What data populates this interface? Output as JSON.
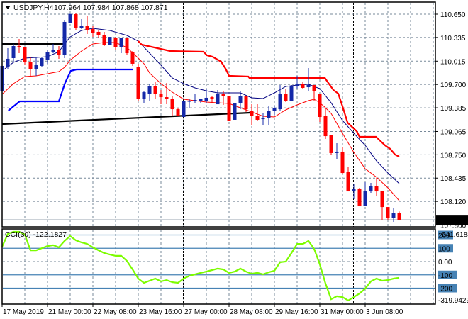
{
  "window": {
    "symbol_title": "USDJPY,H4",
    "ohlc_readout": "107.964 107.984 107.868 107.871",
    "menu_icon": "triangle-down-icon"
  },
  "colors": {
    "bull_candle": "#1428a8",
    "bear_candle": "#ff0000",
    "ma_navy": "#000080",
    "ma_red": "#ff0000",
    "stop_red": "#ff0000",
    "stop_blue": "#0000ff",
    "trendline": "#000000",
    "cci_line": "#7cfc00",
    "cci_levels": "#4682b4",
    "grid": "#778899",
    "current_price_bg": "#000000"
  },
  "chart_data": [
    {
      "type": "candlestick",
      "title": "USDJPY,H4",
      "grid": true,
      "x_tick_labels": [
        {
          "bar": 0,
          "label": "17 May 2019"
        },
        {
          "bar": 8,
          "label": "21 May 00:00"
        },
        {
          "bar": 16,
          "label": "22 May 08:00"
        },
        {
          "bar": 24,
          "label": "23 May 16:00"
        },
        {
          "bar": 32,
          "label": "27 May 00:00"
        },
        {
          "bar": 40,
          "label": "28 May 08:00"
        },
        {
          "bar": 48,
          "label": "29 May 16:00"
        },
        {
          "bar": 56,
          "label": "31 May 00:00"
        },
        {
          "bar": 64,
          "label": "3 Jun 08:00"
        }
      ],
      "period_separators_bars": [
        2,
        32,
        62
      ],
      "y_ticks": [
        "110.650",
        "110.335",
        "110.015",
        "109.700",
        "109.385",
        "109.065",
        "108.750",
        "108.435",
        "108.120",
        "107.800"
      ],
      "current_price": "107.871",
      "ohlc": [
        [
          109.615,
          109.98,
          109.596,
          109.951
        ],
        [
          109.932,
          110.19,
          109.903,
          110.047
        ],
        [
          110.056,
          110.248,
          110.008,
          110.219
        ],
        [
          110.219,
          110.315,
          110.123,
          110.2
        ],
        [
          110.209,
          110.209,
          109.96,
          109.999
        ],
        [
          110.008,
          110.066,
          109.817,
          109.912
        ],
        [
          109.912,
          110.066,
          109.817,
          109.96
        ],
        [
          109.951,
          110.066,
          109.941,
          110.056
        ],
        [
          110.037,
          110.171,
          109.98,
          110.142
        ],
        [
          110.142,
          110.248,
          110.123,
          110.171
        ],
        [
          110.171,
          110.219,
          110.047,
          110.104
        ],
        [
          110.104,
          110.573,
          110.056,
          110.545
        ],
        [
          110.535,
          110.66,
          110.525,
          110.65
        ],
        [
          110.65,
          110.66,
          110.439,
          110.468
        ],
        [
          110.468,
          110.583,
          110.449,
          110.487
        ],
        [
          110.487,
          110.621,
          110.382,
          110.439
        ],
        [
          110.449,
          110.487,
          110.343,
          110.401
        ],
        [
          110.411,
          110.439,
          110.334,
          110.363
        ],
        [
          110.372,
          110.411,
          110.219,
          110.238
        ],
        [
          110.238,
          110.343,
          110.238,
          110.343
        ],
        [
          110.334,
          110.343,
          110.171,
          110.2
        ],
        [
          110.2,
          110.334,
          110.123,
          110.334
        ],
        [
          110.334,
          110.334,
          110.094,
          110.123
        ],
        [
          110.142,
          110.152,
          109.951,
          109.98
        ],
        [
          109.932,
          109.98,
          109.472,
          109.501
        ],
        [
          109.501,
          109.615,
          109.453,
          109.596
        ],
        [
          109.568,
          109.711,
          109.472,
          109.673
        ],
        [
          109.673,
          109.74,
          109.501,
          109.568
        ],
        [
          109.577,
          109.625,
          109.433,
          109.529
        ],
        [
          109.529,
          109.721,
          109.433,
          109.501
        ],
        [
          109.51,
          109.548,
          109.271,
          109.366
        ],
        [
          109.366,
          109.386,
          109.271,
          109.271
        ],
        [
          109.261,
          109.472,
          109.261,
          109.472
        ],
        [
          109.472,
          109.501,
          109.386,
          109.481
        ],
        [
          109.472,
          109.577,
          109.443,
          109.491
        ],
        [
          109.472,
          109.501,
          109.443,
          109.501
        ],
        [
          109.481,
          109.644,
          109.443,
          109.52
        ],
        [
          109.529,
          109.539,
          109.453,
          109.501
        ],
        [
          109.433,
          109.625,
          109.433,
          109.577
        ],
        [
          109.577,
          109.606,
          109.424,
          109.548
        ],
        [
          109.539,
          109.539,
          109.213,
          109.213
        ],
        [
          109.223,
          109.443,
          109.223,
          109.443
        ],
        [
          109.443,
          109.606,
          109.366,
          109.539
        ],
        [
          109.539,
          109.548,
          109.328,
          109.366
        ],
        [
          109.338,
          109.433,
          109.146,
          109.271
        ],
        [
          109.271,
          109.433,
          109.213,
          109.223
        ],
        [
          109.232,
          109.309,
          109.146,
          109.251
        ],
        [
          109.242,
          109.414,
          109.156,
          109.347
        ],
        [
          109.338,
          109.414,
          109.29,
          109.376
        ],
        [
          109.366,
          109.692,
          109.338,
          109.568
        ],
        [
          109.568,
          109.635,
          109.462,
          109.481
        ],
        [
          109.481,
          109.692,
          109.472,
          109.673
        ],
        [
          109.673,
          109.817,
          109.635,
          109.702
        ],
        [
          109.702,
          109.74,
          109.635,
          109.654
        ],
        [
          109.663,
          109.922,
          109.615,
          109.692
        ],
        [
          109.692,
          109.692,
          109.472,
          109.606
        ],
        [
          109.568,
          109.568,
          109.194,
          109.261
        ],
        [
          109.271,
          109.386,
          108.964,
          109.002
        ],
        [
          109.012,
          109.022,
          108.744,
          108.773
        ],
        [
          108.773,
          108.907,
          108.696,
          108.792
        ],
        [
          108.792,
          108.859,
          108.495,
          108.504
        ],
        [
          108.514,
          108.581,
          108.255,
          108.255
        ],
        [
          108.255,
          108.351,
          108.15,
          108.284
        ],
        [
          108.294,
          108.303,
          108.054,
          108.054
        ],
        [
          108.063,
          108.38,
          108.063,
          108.265
        ],
        [
          108.255,
          108.37,
          108.236,
          108.332
        ],
        [
          108.332,
          108.437,
          108.188,
          108.255
        ],
        [
          108.265,
          108.265,
          107.872,
          108.044
        ],
        [
          108.044,
          108.044,
          107.872,
          107.901
        ],
        [
          107.901,
          108.035,
          107.843,
          107.968
        ],
        [
          107.964,
          107.984,
          107.868,
          107.871
        ]
      ],
      "overlays": [
        {
          "style": "ma_navy",
          "points": [
            [
              0,
              109.884
            ],
            [
              2,
              109.999
            ],
            [
              4,
              110.056
            ],
            [
              6,
              110.066
            ],
            [
              8,
              110.075
            ],
            [
              10,
              110.142
            ],
            [
              11,
              110.248
            ],
            [
              12,
              110.343
            ],
            [
              14,
              110.43
            ],
            [
              16,
              110.458
            ],
            [
              19,
              110.43
            ],
            [
              22,
              110.363
            ],
            [
              24,
              110.286
            ],
            [
              26,
              110.123
            ],
            [
              28,
              109.96
            ],
            [
              30,
              109.788
            ],
            [
              32,
              109.711
            ],
            [
              34,
              109.654
            ],
            [
              36,
              109.615
            ],
            [
              38,
              109.587
            ],
            [
              42,
              109.587
            ],
            [
              44,
              109.52
            ],
            [
              46,
              109.51
            ],
            [
              48,
              109.587
            ],
            [
              50,
              109.673
            ],
            [
              52,
              109.692
            ],
            [
              54,
              109.702
            ],
            [
              56,
              109.644
            ],
            [
              58,
              109.453
            ],
            [
              60,
              109.213
            ],
            [
              62,
              109.041
            ],
            [
              64,
              108.878
            ],
            [
              66,
              108.667
            ],
            [
              68,
              108.504
            ],
            [
              70,
              108.361
            ]
          ]
        },
        {
          "style": "ma_red",
          "points": [
            [
              0,
              109.568
            ],
            [
              2,
              109.711
            ],
            [
              4,
              109.807
            ],
            [
              6,
              109.817
            ],
            [
              8,
              109.845
            ],
            [
              10,
              109.874
            ],
            [
              11,
              109.932
            ],
            [
              12,
              110.027
            ],
            [
              14,
              110.152
            ],
            [
              16,
              110.248
            ],
            [
              18,
              110.267
            ],
            [
              20,
              110.267
            ],
            [
              22,
              110.2
            ],
            [
              24,
              110.056
            ],
            [
              25,
              109.98
            ],
            [
              26,
              109.855
            ],
            [
              28,
              109.711
            ],
            [
              30,
              109.596
            ],
            [
              32,
              109.501
            ],
            [
              36,
              109.462
            ],
            [
              40,
              109.443
            ],
            [
              44,
              109.328
            ],
            [
              46,
              109.271
            ],
            [
              48,
              109.261
            ],
            [
              50,
              109.357
            ],
            [
              52,
              109.424
            ],
            [
              54,
              109.481
            ],
            [
              55,
              109.501
            ],
            [
              56,
              109.453
            ],
            [
              57,
              109.386
            ],
            [
              58,
              109.309
            ],
            [
              60,
              109.041
            ],
            [
              62,
              108.782
            ],
            [
              64,
              108.562
            ],
            [
              66,
              108.447
            ],
            [
              68,
              108.303
            ],
            [
              70,
              108.131
            ]
          ]
        },
        {
          "style": "stop_red",
          "points": [
            [
              24,
              110.286
            ],
            [
              24.6,
              110.238
            ],
            [
              29.6,
              110.152
            ],
            [
              35.5,
              110.142
            ],
            [
              36.1,
              110.094
            ],
            [
              37.1,
              110.075
            ],
            [
              38.6,
              110.008
            ],
            [
              39.4,
              109.912
            ],
            [
              40,
              109.817
            ],
            [
              43.4,
              109.807
            ],
            [
              43.6,
              109.788
            ],
            [
              56.9,
              109.788
            ],
            [
              57.5,
              109.721
            ],
            [
              58.4,
              109.625
            ],
            [
              59.25,
              109.577
            ],
            [
              60,
              109.405
            ],
            [
              60.9,
              109.184
            ],
            [
              62.5,
              109.069
            ],
            [
              63,
              108.993
            ],
            [
              65.9,
              108.993
            ],
            [
              67.5,
              108.878
            ],
            [
              68.4,
              108.83
            ],
            [
              69.25,
              108.753
            ],
            [
              70,
              108.725
            ]
          ]
        },
        {
          "style": "stop_blue",
          "points": [
            [
              1.1,
              109.347
            ],
            [
              3.1,
              109.472
            ],
            [
              10,
              109.472
            ],
            [
              11.1,
              109.721
            ],
            [
              12.1,
              109.884
            ],
            [
              13.1,
              109.903
            ],
            [
              23.1,
              109.903
            ]
          ]
        },
        {
          "style": "trendline",
          "points": [
            [
              0,
              110.248
            ],
            [
              11,
              110.248
            ]
          ]
        },
        {
          "style": "trendline",
          "points": [
            [
              0,
              109.165
            ],
            [
              43.75,
              109.319
            ]
          ]
        }
      ]
    },
    {
      "type": "line",
      "title": "CCI(30) -122.1827",
      "grid": true,
      "y_max_label": "241.6188",
      "y_min_label": "-319.9423",
      "level_labels": [
        "200",
        "100",
        "0.00",
        "-100",
        "-200"
      ],
      "levels": [
        200,
        100,
        -100,
        -200
      ],
      "values": [
        112,
        208,
        224,
        224,
        203,
        85,
        85,
        101,
        117,
        123,
        107,
        155,
        192,
        160,
        144,
        133,
        107,
        85,
        64,
        53,
        43,
        43,
        5,
        -59,
        -128,
        -160,
        -144,
        -128,
        -149,
        -139,
        -155,
        -160,
        -128,
        -107,
        -96,
        -85,
        -75,
        -64,
        -53,
        -59,
        -85,
        -75,
        -53,
        -75,
        -91,
        -85,
        -96,
        -80,
        -69,
        -5,
        0,
        64,
        133,
        133,
        155,
        96,
        -21,
        -165,
        -283,
        -261,
        -267,
        -293,
        -267,
        -240,
        -203,
        -149,
        -128,
        -144,
        -139,
        -128,
        -122
      ]
    }
  ]
}
